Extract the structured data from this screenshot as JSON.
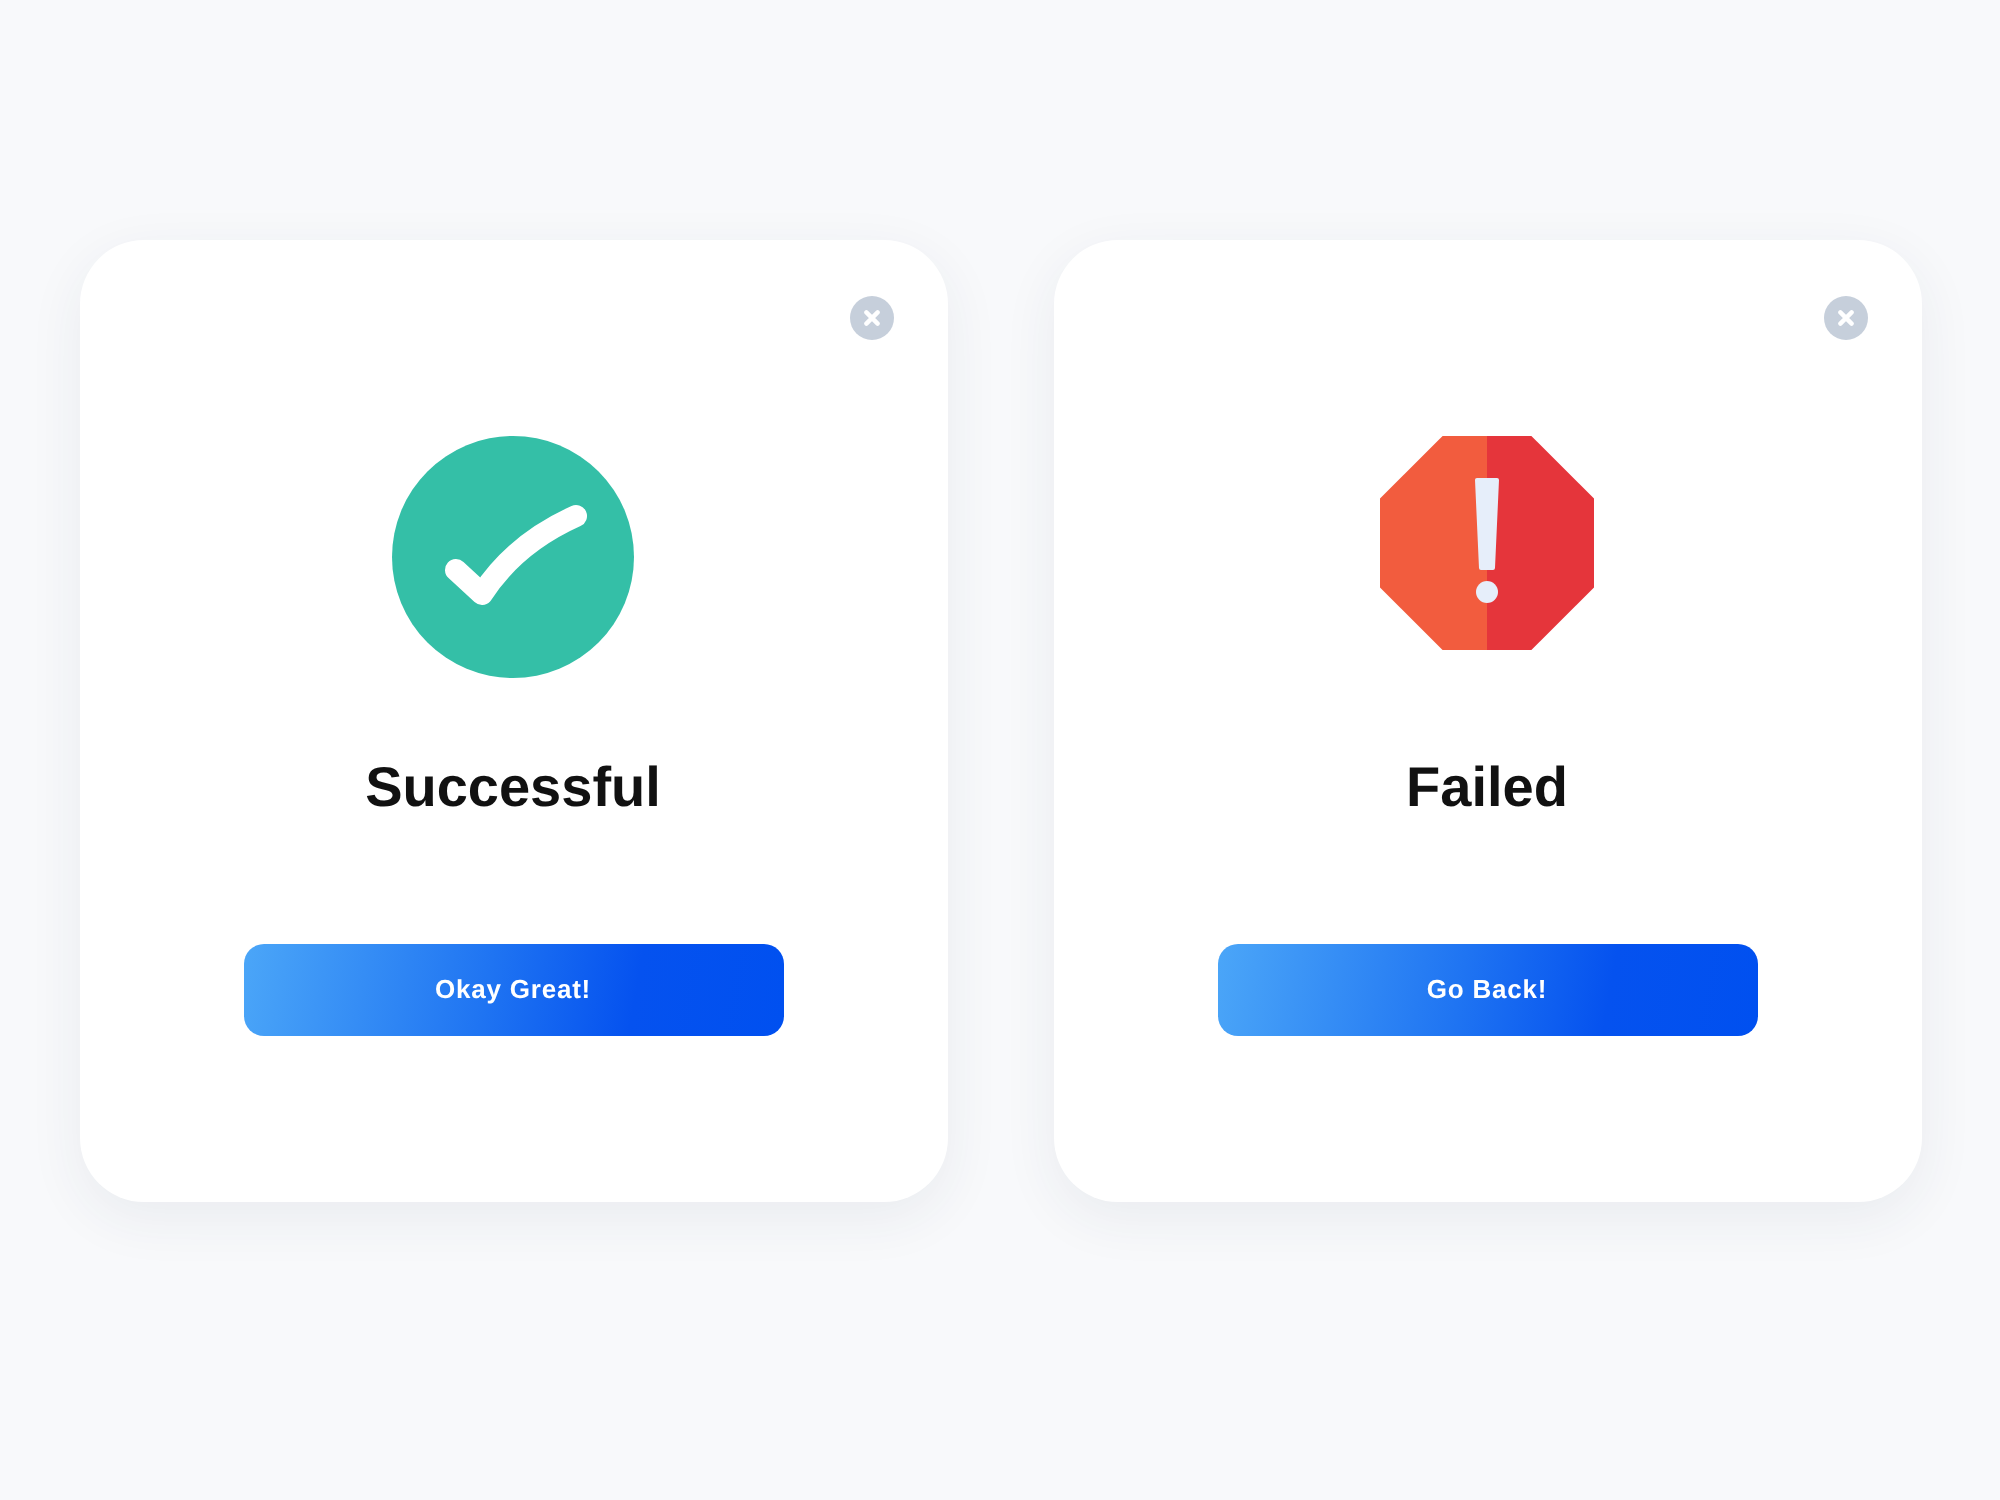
{
  "dialogs": [
    {
      "kind": "success",
      "title": "Successful",
      "button": "Okay Great!"
    },
    {
      "kind": "error",
      "title": "Failed",
      "button": "Go Back!"
    }
  ]
}
